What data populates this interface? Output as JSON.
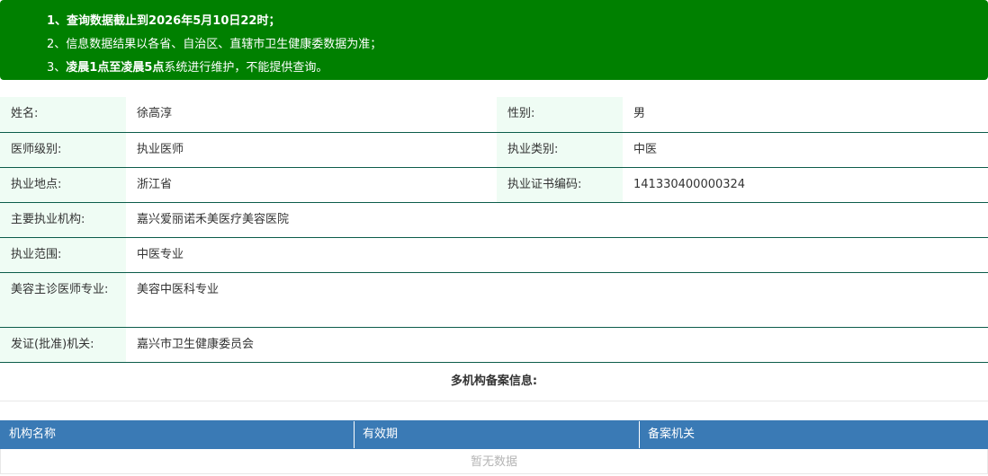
{
  "notice": {
    "line1_prefix": "1、查询数据截止到",
    "line1_date": "2026年5月10日22时",
    "line1_suffix": "；",
    "line2": "2、信息数据结果以各省、自治区、直辖市卫生健康委数据为准；",
    "line3_prefix": "3、",
    "line3_bold": "凌晨1点至凌晨5点",
    "line3_suffix": "系统进行维护，不能提供查询。"
  },
  "info": {
    "name_label": "姓名:",
    "name_value": "徐高淳",
    "gender_label": "性别:",
    "gender_value": "男",
    "level_label": "医师级别:",
    "level_value": "执业医师",
    "category_label": "执业类别:",
    "category_value": "中医",
    "location_label": "执业地点:",
    "location_value": "浙江省",
    "cert_label": "执业证书编码:",
    "cert_value": "141330400000324",
    "institution_label": "主要执业机构:",
    "institution_value": "嘉兴爱丽诺禾美医疗美容医院",
    "scope_label": "执业范围:",
    "scope_value": "中医专业",
    "beauty_label": "美容主诊医师专业:",
    "beauty_value": "美容中医科专业",
    "issuer_label": "发证(批准)机关:",
    "issuer_value": "嘉兴市卫生健康委员会"
  },
  "multi": {
    "title": "多机构备案信息:",
    "columns": [
      "机构名称",
      "有效期",
      "备案机关"
    ],
    "empty_text": "暂无数据"
  }
}
